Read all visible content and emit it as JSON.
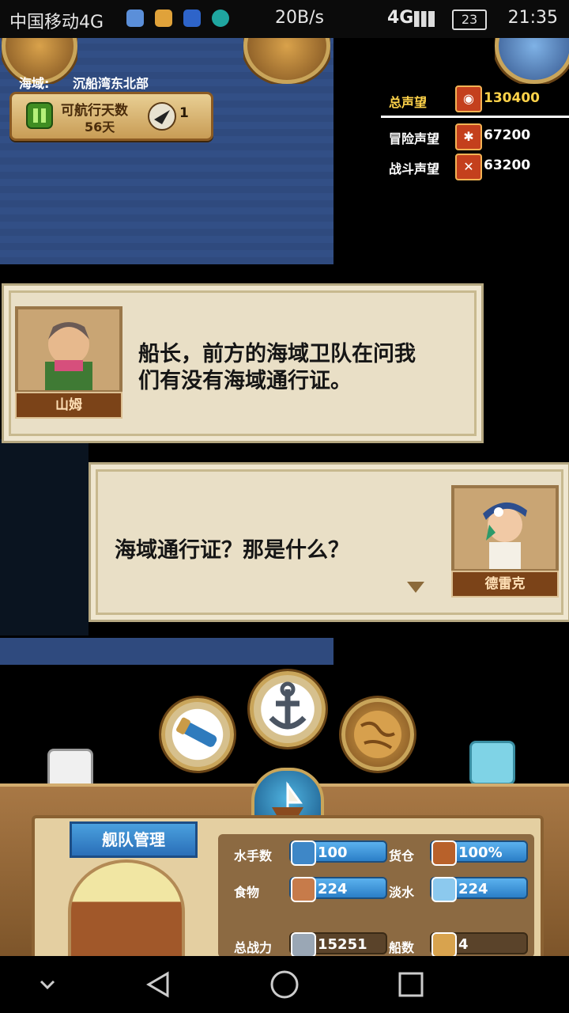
{
  "statusbar": {
    "carrier": "中国移动4G",
    "speed": "20B/s",
    "network": "4G",
    "battery": "23",
    "time": "21:35"
  },
  "sea": {
    "region_label": "海域:",
    "region_name": "沉船湾东北部",
    "days_label": "可航行天数",
    "days_value": "56天",
    "ship_count": "1"
  },
  "reputation": {
    "total_label": "总声望",
    "total_value": "130400",
    "adventure_label": "冒险声望",
    "adventure_value": "67200",
    "battle_label": "战斗声望",
    "battle_value": "63200"
  },
  "dialog1": {
    "speaker": "山姆",
    "text_line1": "船长，前方的海域卫队在问我",
    "text_line2": "们有没有海域通行证。"
  },
  "dialog2": {
    "speaker": "德雷克",
    "text": "海域通行证？那是什么？"
  },
  "hud": {
    "fleet_title": "舰队管理",
    "sailors_label": "水手数",
    "sailors_value": "100",
    "cargo_label": "货仓",
    "cargo_value": "100%",
    "food_label": "食物",
    "food_value": "224",
    "water_label": "淡水",
    "water_value": "224",
    "power_label": "总战力",
    "power_value": "15251",
    "ships_label": "船数",
    "ships_value": "4"
  },
  "colors": {
    "sea": "#2f4a7e",
    "dialog_bg": "#e9dfc6",
    "nameplate": "#7b4318",
    "bar_blue": "#2b7fc7"
  }
}
